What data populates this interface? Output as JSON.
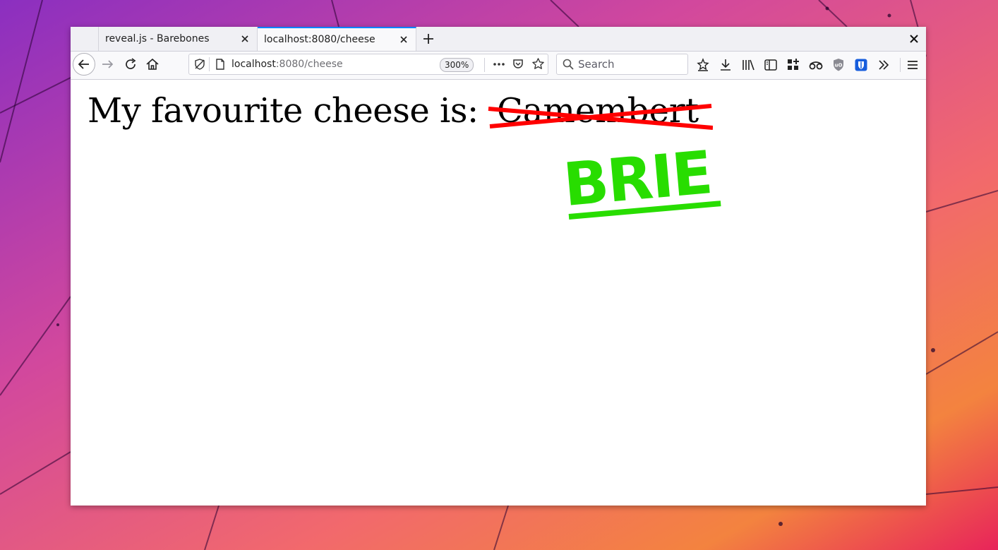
{
  "tabs": [
    {
      "label": "reveal.js - Barebones",
      "active": false
    },
    {
      "label": "localhost:8080/cheese",
      "active": true
    }
  ],
  "urlbar": {
    "host": "localhost",
    "path": ":8080/cheese",
    "zoom": "300%"
  },
  "search": {
    "placeholder": "Search"
  },
  "page": {
    "prefix": "My favourite cheese is:",
    "struck_word": "Camembert",
    "replacement": "BRIE"
  },
  "colors": {
    "strike": "#ff0000",
    "replacement": "#28dd00",
    "tab_accent": "#0a84ff"
  },
  "icons": [
    "back-icon",
    "forward-icon",
    "reload-icon",
    "home-icon",
    "tracking-protection-icon",
    "page-icon",
    "page-actions-icon",
    "pocket-icon",
    "bookmark-star-icon",
    "search-icon",
    "bookmark-menu-icon",
    "download-icon",
    "library-icon",
    "sidebar-icon",
    "extension-grid-icon",
    "tracker-icon",
    "ublock-icon",
    "bitwarden-icon",
    "overflow-icon",
    "hamburger-menu-icon",
    "new-tab-icon",
    "close-icon"
  ]
}
